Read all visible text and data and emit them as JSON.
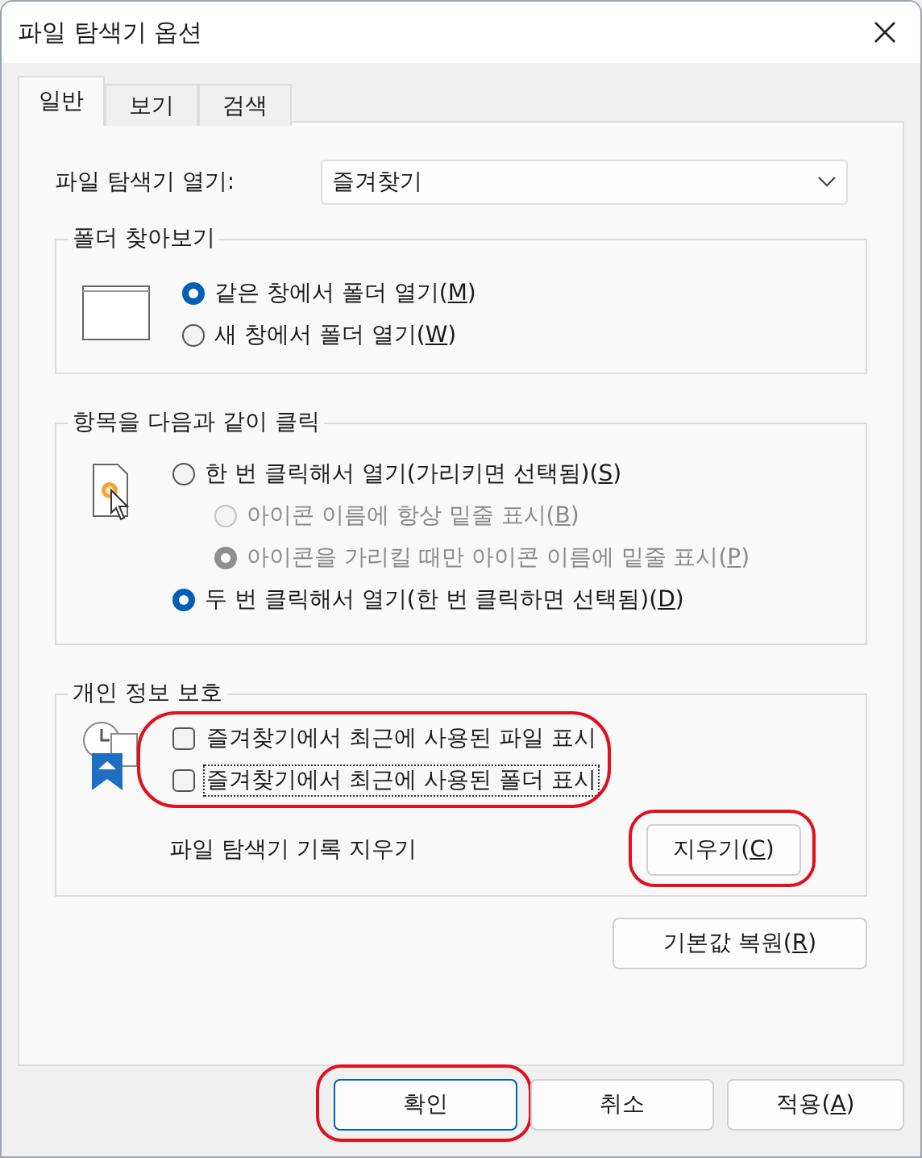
{
  "window": {
    "title": "파일 탐색기 옵션"
  },
  "tabs": [
    {
      "label": "일반",
      "selected": true
    },
    {
      "label": "보기",
      "selected": false
    },
    {
      "label": "검색",
      "selected": false
    }
  ],
  "open_in": {
    "label": "파일 탐색기 열기:",
    "value": "즐겨찾기"
  },
  "browse_folders": {
    "title": "폴더 찾아보기",
    "options": [
      {
        "text": "같은 창에서 폴더 열기(",
        "key": "M",
        "tail": ")",
        "selected": true,
        "disabled": false
      },
      {
        "text": "새 창에서 폴더 열기(",
        "key": "W",
        "tail": ")",
        "selected": false,
        "disabled": false
      }
    ]
  },
  "click_items": {
    "title": "항목을 다음과 같이 클릭",
    "options": [
      {
        "text": "한 번 클릭해서 열기(가리키면 선택됨)(",
        "key": "S",
        "tail": ")",
        "selected": false,
        "disabled": false,
        "children": [
          {
            "text": "아이콘 이름에 항상 밑줄 표시(",
            "key": "B",
            "tail": ")",
            "selected": false,
            "disabled": true
          },
          {
            "text": "아이콘을 가리킬 때만 아이콘 이름에 밑줄 표시(",
            "key": "P",
            "tail": ")",
            "selected": true,
            "disabled": true
          }
        ]
      },
      {
        "text": "두 번 클릭해서 열기(한 번 클릭하면 선택됨)(",
        "key": "D",
        "tail": ")",
        "selected": true,
        "disabled": false
      }
    ]
  },
  "privacy": {
    "title": "개인 정보 보호",
    "highlighted": true,
    "checkboxes": [
      {
        "text": "즐겨찾기에서 최근에 사용된 파일 표시",
        "checked": false,
        "focused": false
      },
      {
        "text": "즐겨찾기에서 최근에 사용된 폴더 표시",
        "checked": false,
        "focused": true
      }
    ],
    "clear_label": "파일 탐색기 기록 지우기",
    "clear_button": {
      "text": "지우기(",
      "key": "C",
      "tail": ")",
      "highlighted": true
    }
  },
  "restore_button": {
    "text": "기본값 복원(",
    "key": "R",
    "tail": ")"
  },
  "buttons": [
    {
      "text": "확인",
      "default": true,
      "highlighted": true
    },
    {
      "text": "취소",
      "default": false,
      "highlighted": false
    },
    {
      "text": "적용(",
      "key": "A",
      "tail": ")",
      "default": false,
      "highlighted": false
    }
  ]
}
